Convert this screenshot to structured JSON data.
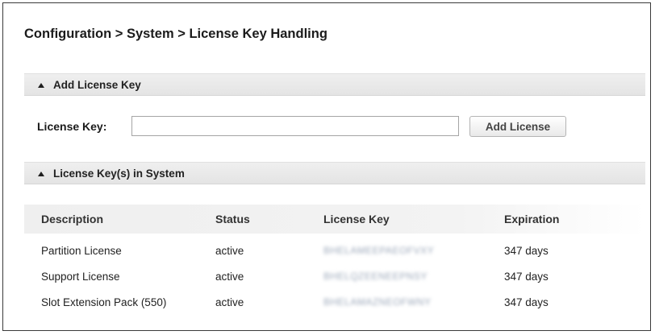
{
  "breadcrumb": "Configuration > System > License Key Handling",
  "add_section": {
    "title": "Add License Key",
    "field_label": "License Key:",
    "field_value": "",
    "button_label": "Add License"
  },
  "list_section": {
    "title": "License Key(s) in System",
    "columns": {
      "description": "Description",
      "status": "Status",
      "license_key": "License Key",
      "expiration": "Expiration"
    },
    "rows": [
      {
        "description": "Partition License",
        "status": "active",
        "license_key": "BHELAMEEPAEOFVXY",
        "expiration": "347 days"
      },
      {
        "description": "Support License",
        "status": "active",
        "license_key": "BHELQZEENEEPNSY",
        "expiration": "347 days"
      },
      {
        "description": "Slot Extension Pack (550)",
        "status": "active",
        "license_key": "BHELAMAZNEOFWNY",
        "expiration": "347 days"
      }
    ]
  }
}
